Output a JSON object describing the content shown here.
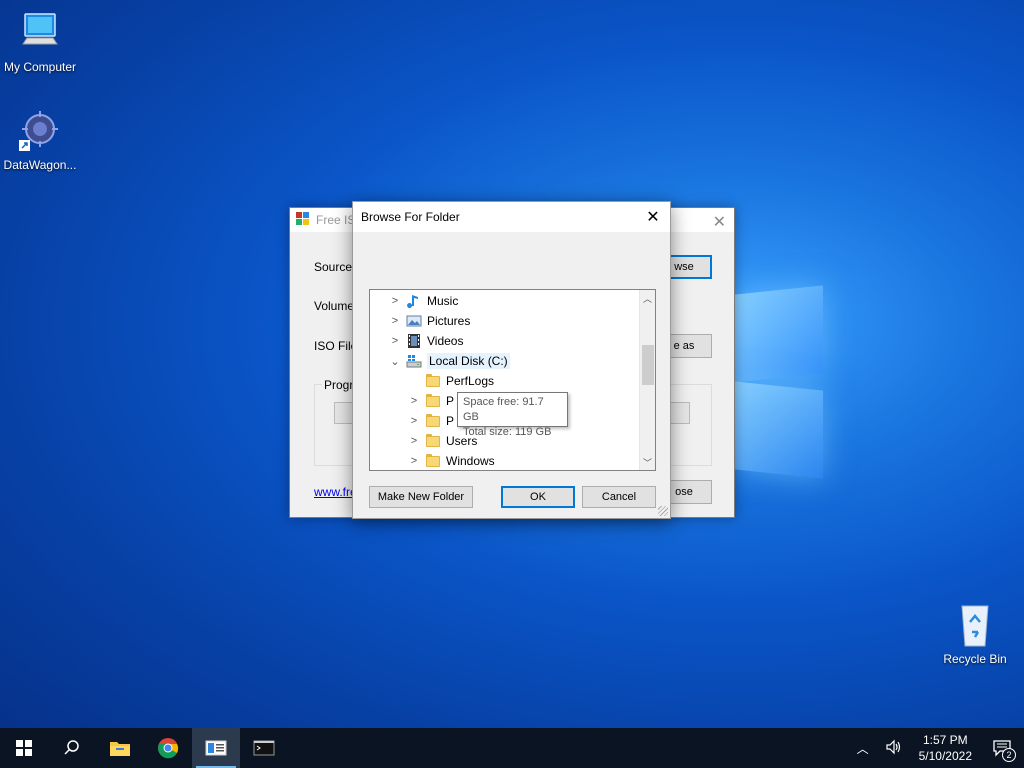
{
  "desktop": {
    "icons": [
      {
        "label": "My Computer"
      },
      {
        "label": "DataWagon..."
      },
      {
        "label": "Recycle Bin"
      }
    ]
  },
  "app_window": {
    "title": "Free ISO",
    "labels": {
      "source": "Source I",
      "volume": "Volume",
      "iso_file": "ISO File",
      "progress": "Progre"
    },
    "buttons": {
      "browse": "wse",
      "save_as": "e as",
      "close": "ose"
    },
    "link": "www.fre"
  },
  "dialog": {
    "title": "Browse For Folder",
    "tree": [
      {
        "label": "Music",
        "icon": "music-icon",
        "expander": "collapsed"
      },
      {
        "label": "Pictures",
        "icon": "pictures-icon",
        "expander": "collapsed"
      },
      {
        "label": "Videos",
        "icon": "videos-icon",
        "expander": "collapsed"
      },
      {
        "label": "Local Disk (C:)",
        "icon": "drive-icon",
        "expander": "expanded"
      },
      {
        "label": "PerfLogs",
        "icon": "folder-icon",
        "expander": "none"
      },
      {
        "label": "P",
        "icon": "folder-icon",
        "expander": "collapsed"
      },
      {
        "label": "P",
        "icon": "folder-icon",
        "expander": "collapsed"
      },
      {
        "label": "Users",
        "icon": "folder-icon",
        "expander": "collapsed"
      },
      {
        "label": "Windows",
        "icon": "folder-icon",
        "expander": "collapsed"
      }
    ],
    "tooltip": {
      "line1": "Space free: 91.7 GB",
      "line2": "Total size: 119 GB"
    },
    "buttons": {
      "make_new_folder": "Make New Folder",
      "ok": "OK",
      "cancel": "Cancel"
    }
  },
  "taskbar": {
    "time": "1:57 PM",
    "date": "5/10/2022",
    "notification_count": "2"
  }
}
